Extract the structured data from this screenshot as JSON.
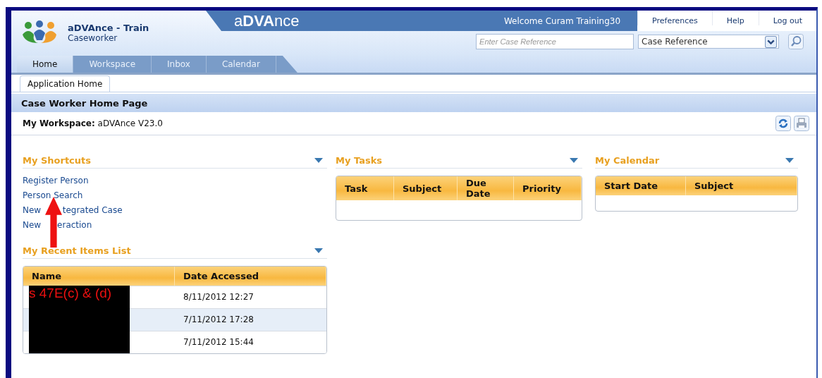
{
  "header": {
    "app_title": "aDVAnce - Train",
    "role": "Caseworker",
    "brand": "a**DVA**nce",
    "welcome": "Welcome Curam Training30",
    "links": [
      "Preferences",
      "Help",
      "Log out"
    ],
    "search": {
      "placeholder": "Enter Case Reference",
      "type_value": "Case Reference"
    }
  },
  "tabs": [
    {
      "label": "Home",
      "selected": true
    },
    {
      "label": "Workspace",
      "selected": false
    },
    {
      "label": "Inbox",
      "selected": false
    },
    {
      "label": "Calendar",
      "selected": false
    }
  ],
  "subtabs": [
    {
      "label": "Application Home",
      "selected": true
    }
  ],
  "page_title": "Case Worker Home Page",
  "workspace": {
    "label": "My Workspace:",
    "value": "aDVAnce V23.0"
  },
  "shortcuts": {
    "title": "My Shortcuts",
    "items": [
      "Register Person",
      "Person Search",
      "New        tegrated Case",
      "New      eraction"
    ]
  },
  "recent_items": {
    "title": "My Recent Items List",
    "columns": [
      "Name",
      "Date Accessed"
    ],
    "rows": [
      {
        "name": "s 47E(c) & (d)",
        "redacted": true,
        "date_accessed": "8/11/2012 12:27",
        "selected": false
      },
      {
        "redacted": true,
        "date_accessed": "7/11/2012 17:28",
        "selected": true
      },
      {
        "redacted": true,
        "date_accessed": "7/11/2012 15:44",
        "selected": false
      }
    ]
  },
  "tasks": {
    "title": "My Tasks",
    "columns": [
      "Task",
      "Subject",
      "Due Date",
      "Priority"
    ]
  },
  "calendar": {
    "title": "My Calendar",
    "columns": [
      "Start Date",
      "Subject"
    ]
  }
}
